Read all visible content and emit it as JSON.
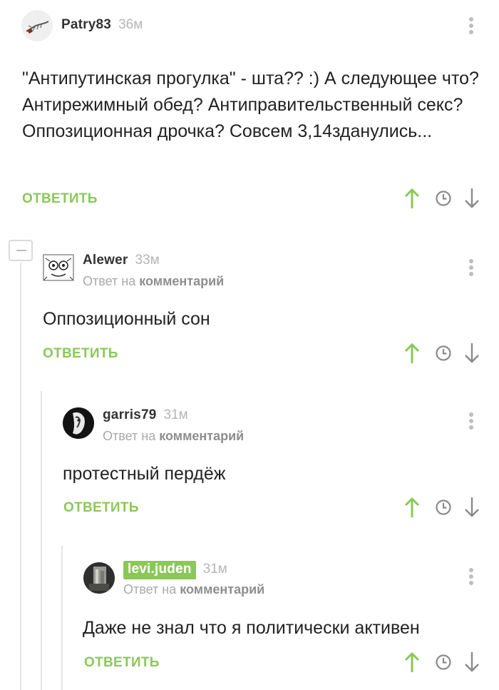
{
  "comments": [
    {
      "username": "Patry83",
      "time": "36м",
      "reply_to": null,
      "text": "\"Антипутинская прогулка\" - шта?? :) А следующее что? Антирежимный обед? Антиправительственный секс? Оппозиционная дрочка? Совсем 3,14зданулись...",
      "reply_label": "ОТВЕТИТЬ",
      "avatar_icon": "fishing-lure-avatar"
    },
    {
      "username": "Alewer",
      "time": "33м",
      "reply_to_prefix": "Ответ на",
      "reply_to_link": "комментарий",
      "text": "Оппозиционный сон",
      "reply_label": "ОТВЕТИТЬ",
      "avatar_icon": "doodle-face-avatar"
    },
    {
      "username": "garris79",
      "time": "31м",
      "reply_to_prefix": "Ответ на",
      "reply_to_link": "комментарий",
      "text": "протестный пердёж",
      "reply_label": "ОТВЕТИТЬ",
      "avatar_icon": "dark-portrait-avatar"
    },
    {
      "username": "levi.juden",
      "time": "31м",
      "reply_to_prefix": "Ответ на",
      "reply_to_link": "комментарий",
      "text": "Даже не знал что я политически активен",
      "reply_label": "ОТВЕТИТЬ",
      "avatar_icon": "photo-avatar",
      "username_highlighted": true
    }
  ],
  "icons": {
    "upvote": "arrow-up-icon",
    "time": "clock-icon",
    "downvote": "arrow-down-icon",
    "menu": "more-vertical-icon",
    "collapse": "minus-icon"
  },
  "colors": {
    "accent_green": "#8ac858",
    "thread_line": "#e4e4e4",
    "meta_gray": "#a9a9a9"
  }
}
